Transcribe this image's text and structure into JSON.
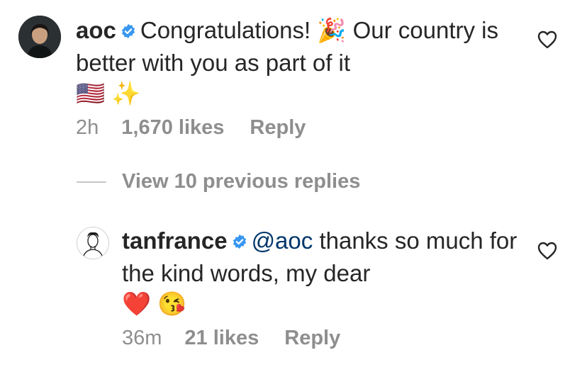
{
  "comments": [
    {
      "username": "aoc",
      "text": "Congratulations! 🎉 Our country is better with you as part of it",
      "emojis": "🇺🇸 ✨",
      "time": "2h",
      "likes": "1,670 likes",
      "reply": "Reply",
      "verified": true,
      "icons": {
        "avatar": "avatar",
        "verified": "verified-badge-icon",
        "like": "heart-icon"
      }
    },
    {
      "username": "tanfrance",
      "mention": "@aoc",
      "text": "thanks so much for the kind words, my dear",
      "emojis": "❤️ 😘",
      "time": "36m",
      "likes": "21 likes",
      "reply": "Reply",
      "verified": true,
      "icons": {
        "avatar": "avatar",
        "verified": "verified-badge-icon",
        "like": "heart-icon"
      }
    }
  ],
  "view_replies": "View 10 previous replies",
  "colors": {
    "text": "#262626",
    "secondary": "#8e8e8e",
    "mention": "#00376b",
    "verified": "#3897f0"
  }
}
